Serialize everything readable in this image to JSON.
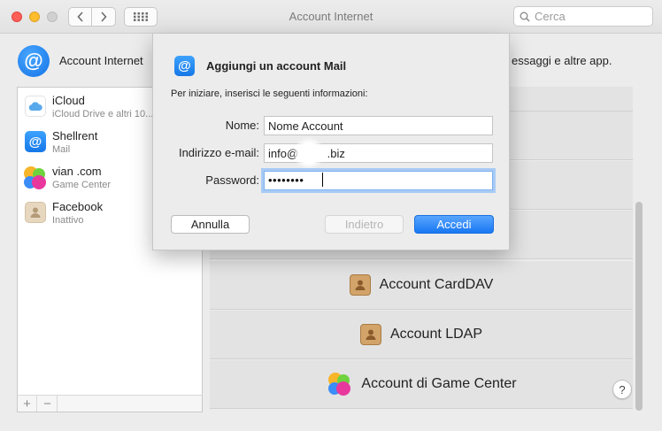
{
  "window": {
    "title": "Account Internet",
    "search_placeholder": "Cerca"
  },
  "header": {
    "title": "Account Internet",
    "description_tail": "essaggi e altre app."
  },
  "sidebar": {
    "accounts": [
      {
        "name": "iCloud",
        "detail": "iCloud Drive e altri 10..."
      },
      {
        "name": "Shellrent",
        "detail": "Mail"
      },
      {
        "name": "vian          .com",
        "detail": "Game Center"
      },
      {
        "name": "Facebook",
        "detail": "Inattivo"
      }
    ],
    "add_label": "+",
    "remove_label": "−"
  },
  "providers": [
    {
      "name": ""
    },
    {
      "name": ""
    },
    {
      "name": ""
    },
    {
      "name": ""
    },
    {
      "name": "Account CardDAV",
      "icon": "contacts-icon"
    },
    {
      "name": "Account LDAP",
      "icon": "contacts-icon"
    },
    {
      "name": "Account di Game Center",
      "icon": "game-center-icon"
    }
  ],
  "help_label": "?",
  "dialog": {
    "title": "Aggiungi un account Mail",
    "subtitle": "Per iniziare, inserisci le seguenti informazioni:",
    "name_label": "Nome:",
    "name_value": "Nome Account",
    "email_label": "Indirizzo e-mail:",
    "email_value": "info@         .biz",
    "password_label": "Password:",
    "password_mask": "••••••••",
    "cancel_label": "Annulla",
    "back_label": "Indietro",
    "submit_label": "Accedi"
  },
  "colors": {
    "accent": "#1877f2",
    "close": "#ff5f57",
    "minimize": "#ffbd2e"
  }
}
